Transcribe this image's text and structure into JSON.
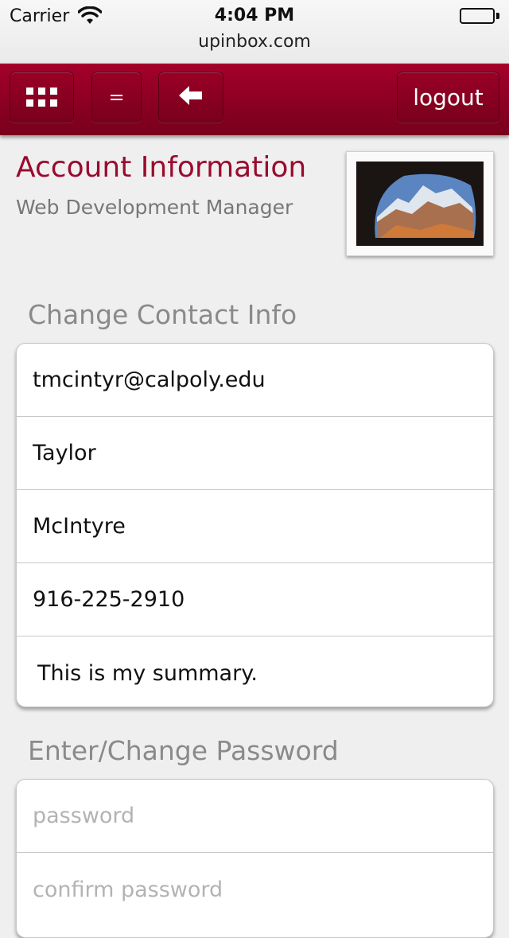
{
  "status_bar": {
    "carrier": "Carrier",
    "time": "4:04 PM",
    "url": "upinbox.com"
  },
  "toolbar": {
    "menu_label": "=",
    "logout_label": "logout",
    "background_color": "#8a0022"
  },
  "header": {
    "title": "Account Information",
    "subtitle": "Web Development Manager",
    "title_color": "#9b0a2e"
  },
  "contact_section": {
    "label": "Change Contact Info",
    "fields": {
      "email": "tmcintyr@calpoly.edu",
      "first_name": "Taylor",
      "last_name": "McIntyre",
      "phone": "916-225-2910",
      "summary": "This is my summary."
    }
  },
  "password_section": {
    "label": "Enter/Change Password",
    "password_placeholder": "password",
    "confirm_placeholder": "confirm password"
  }
}
